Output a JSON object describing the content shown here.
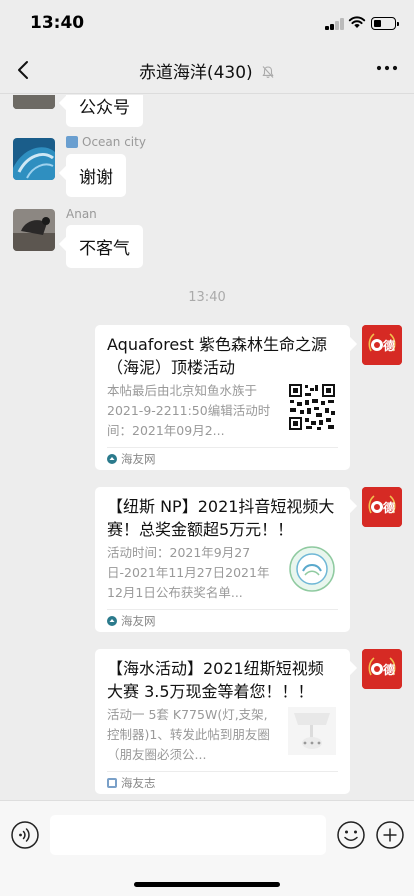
{
  "status_bar": {
    "time": "13:40",
    "battery_level": 0.4
  },
  "nav": {
    "title": "赤道海洋(430)",
    "icons": [
      "back-icon",
      "mute-icon",
      "more-icon"
    ]
  },
  "messages": [
    {
      "sender": "",
      "text": "公众号"
    },
    {
      "sender": "Ocean city",
      "text": "谢谢"
    },
    {
      "sender": "Anan",
      "text": "不客气"
    }
  ],
  "timestamp": "13:40",
  "cards": [
    {
      "title": "Aquaforest 紫色森林生命之源（海泥）顶楼活动",
      "desc": "本帖最后由北京知鱼水族于2021-9-2211:50编辑活动时间：2021年09月2...",
      "source": "海友网",
      "thumb": "qr-code"
    },
    {
      "title": "【纽斯 NP】2021抖音短视频大赛！总奖金额超5万元！！",
      "desc": "活动时间：2021年9月27日-2021年11月27日2021年12月1日公布获奖名单...",
      "source": "海友网",
      "thumb": "round-logo"
    },
    {
      "title": "【海水活动】2021纽斯短视频大赛 3.5万现金等着您！！！",
      "desc": "活动一 5套 K775W(灯,支架,控制器)1、转发此帖到朋友圈（朋友圈必须公...",
      "source": "海友志",
      "thumb": "product-image"
    }
  ],
  "card_avatar_text": "德",
  "input": {
    "placeholder": ""
  },
  "colors": {
    "background": "#ededed",
    "card_avatar": "#d62a24",
    "source_icon": "#2b7a8c"
  }
}
